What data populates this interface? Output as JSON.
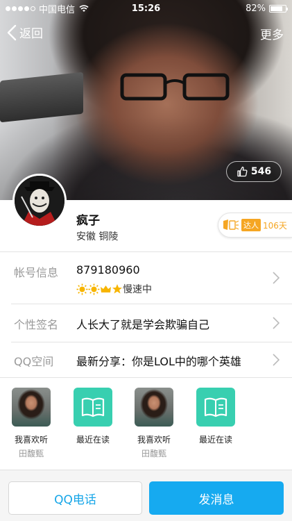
{
  "status_bar": {
    "carrier": "中国电信",
    "time": "15:26",
    "battery": "82%",
    "battery_level": 0.82,
    "signal_bars": 4
  },
  "nav": {
    "back_label": "返回",
    "more_label": "更多"
  },
  "likes": {
    "count": "546"
  },
  "profile": {
    "nickname": "疯子",
    "location": "安徽  铜陵"
  },
  "talent_badge": {
    "tag": "达人",
    "days": "106天"
  },
  "account": {
    "label": "帐号信息",
    "qq_number": "879180960",
    "level_icons": [
      "sun-icon",
      "sun-icon",
      "crown-icon",
      "star-icon"
    ],
    "speed_text": "慢速中"
  },
  "signature": {
    "label": "个性签名",
    "text": "人长大了就是学会欺骗自己"
  },
  "qzone": {
    "label": "QQ空间",
    "text": "最新分享：你是LOL中的哪个英雄"
  },
  "tiles": [
    {
      "icon": "singer-photo",
      "caption": "我喜欢听",
      "sub": "田馥甄"
    },
    {
      "icon": "book-icon",
      "caption": "最近在读",
      "sub": ""
    },
    {
      "icon": "singer-photo",
      "caption": "我喜欢听",
      "sub": "田馥甄"
    },
    {
      "icon": "book-icon",
      "caption": "最近在读",
      "sub": ""
    }
  ],
  "actions": {
    "call_label": "QQ电话",
    "message_label": "发消息"
  },
  "colors": {
    "accent": "#16aaf0",
    "badge": "#f5a623",
    "tile_green": "#38cfb0"
  }
}
